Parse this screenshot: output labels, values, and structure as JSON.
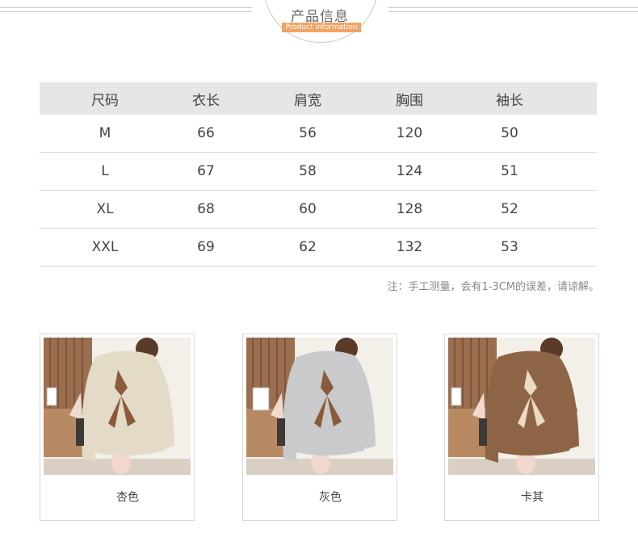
{
  "header": {
    "title": "产品信息",
    "subtitle": "Product information"
  },
  "size_table": {
    "columns": [
      "尺码",
      "衣长",
      "肩宽",
      "胸围",
      "袖长"
    ],
    "rows": [
      [
        "M",
        "66",
        "56",
        "120",
        "50"
      ],
      [
        "L",
        "67",
        "58",
        "124",
        "51"
      ],
      [
        "XL",
        "68",
        "60",
        "128",
        "52"
      ],
      [
        "XXL",
        "69",
        "62",
        "132",
        "53"
      ]
    ],
    "note": "注：手工测量，会有1-3CM的误差，请谅解。"
  },
  "products": [
    {
      "color_name": "杏色",
      "swatch": "#efe8dc",
      "garment": "#e3dac7",
      "bow": "#8a5a3a",
      "wall": "#9b6e4f"
    },
    {
      "color_name": "灰色",
      "swatch": "#d8d8d8",
      "garment": "#c9cacb",
      "bow": "#8a5a3a",
      "wall": "#9b6e4f"
    },
    {
      "color_name": "卡其",
      "swatch": "#8a6047",
      "garment": "#8e6446",
      "bow": "#e9dcc0",
      "wall": "#9b6e4f"
    }
  ]
}
